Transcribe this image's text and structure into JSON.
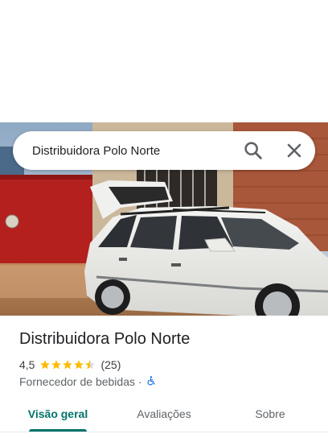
{
  "search": {
    "value": "Distribuidora Polo Norte"
  },
  "place": {
    "name": "Distribuidora Polo Norte",
    "rating": "4,5",
    "stars": 4.5,
    "reviews": "(25)",
    "category": "Fornecedor de bebidas",
    "separator": "·"
  },
  "tabs": [
    {
      "label": "Visão geral",
      "active": true
    },
    {
      "label": "Avaliações",
      "active": false
    },
    {
      "label": "Sobre",
      "active": false
    }
  ],
  "colors": {
    "accent": "#00736b",
    "star": "#fbbc04",
    "accessibility": "#1a73e8"
  },
  "icons": [
    "search-icon",
    "close-icon",
    "star-icon",
    "wheelchair-icon"
  ]
}
